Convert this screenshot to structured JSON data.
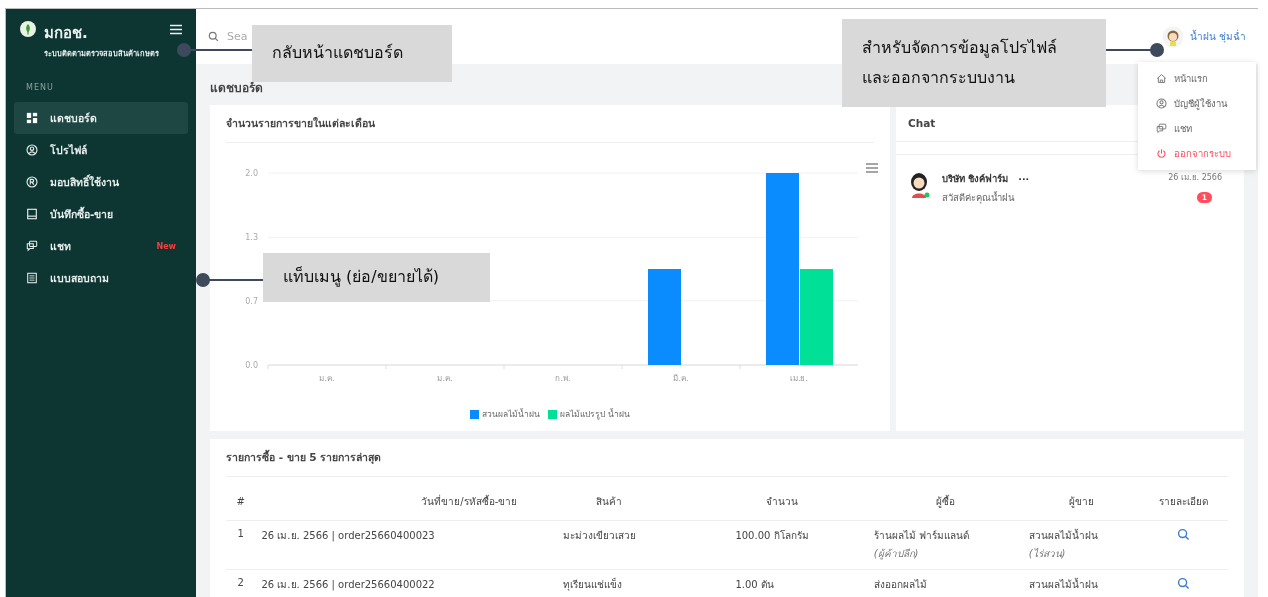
{
  "brand": {
    "name": "มกอช.",
    "subtitle": "ระบบติดตามตรวจสอบสินค้าเกษตร"
  },
  "sidebar": {
    "section": "MENU",
    "items": [
      {
        "label": "แดชบอร์ด",
        "selected": true
      },
      {
        "label": "โปรไฟล์",
        "selected": false
      },
      {
        "label": "มอบสิทธิ์ใช้งาน",
        "selected": false
      },
      {
        "label": "บันทึกซื้อ-ขาย",
        "selected": false
      },
      {
        "label": "แชท",
        "selected": false,
        "badge": "New"
      },
      {
        "label": "แบบสอบถาม",
        "selected": false
      }
    ]
  },
  "search": {
    "placeholder": "Sea"
  },
  "user": {
    "name": "น้ำฝน ชุ่มฉ่ำ"
  },
  "user_menu": [
    {
      "label": "หน้าแรก",
      "kind": "normal"
    },
    {
      "label": "บัญชีผู้ใช้งาน",
      "kind": "normal"
    },
    {
      "label": "แชท",
      "kind": "normal"
    },
    {
      "label": "ออกจากระบบ",
      "kind": "danger"
    }
  ],
  "page_title": "แดชบอร์ด",
  "sales_chart": {
    "title": "จำนวนรายการขายในแต่ละเดือน",
    "chart_data": {
      "type": "bar",
      "categories": [
        "ม.ค.",
        "ม.ค.",
        "ก.พ.",
        "มี.ค.",
        "เม.ย."
      ],
      "series": [
        {
          "name": "สวนผลไม้น้ำฝน",
          "color": "#0a8cff",
          "values": [
            0,
            0,
            0,
            1,
            2
          ]
        },
        {
          "name": "ผลไม้แปรรูป น้ำฝน",
          "color": "#00e096",
          "values": [
            0,
            0,
            0,
            0,
            1
          ]
        }
      ],
      "ylim": [
        0,
        2
      ],
      "yticks": [
        {
          "value": 0,
          "label": "0.0"
        },
        {
          "value": 0.67,
          "label": "0.7"
        },
        {
          "value": 1.33,
          "label": "1.3"
        },
        {
          "value": 2,
          "label": "2.0"
        }
      ]
    }
  },
  "chat": {
    "title": "Chat",
    "items": [
      {
        "name": "บริษัท ชิงค์ฟาร์ม",
        "more": "...",
        "message": "สวัสดีค่ะคุณน้ำฝน",
        "date": "26 เม.ย. 2566",
        "unread": "1"
      }
    ]
  },
  "transactions": {
    "title": "รายการซื้อ - ขาย 5 รายการล่าสุด",
    "columns": [
      "#",
      "วันที่ขาย/รหัสซื้อ-ขาย",
      "สินค้า",
      "จำนวน",
      "ผู้ซื้อ",
      "ผู้ขาย",
      "รายละเอียด"
    ],
    "rows": [
      {
        "no": "1",
        "date_code": "26 เม.ย. 2566 | order25660400023",
        "product": "มะม่วงเขียวเสวย",
        "quantity": "100.00 กิโลกรัม",
        "buyer": "ร้านผลไม้ ฟาร์มแลนด์",
        "buyer_note": "(ผู้ค้าปลีก)",
        "seller": "สวนผลไม้น้ำฝน",
        "seller_note": "(ไร่สวน)"
      },
      {
        "no": "2",
        "date_code": "26 เม.ย. 2566 | order25660400022",
        "product": "ทุเรียนแช่แข็ง",
        "quantity": "1.00 ตัน",
        "buyer": "ส่งออกผลไม้",
        "seller": "สวนผลไม้น้ำฝน"
      }
    ]
  },
  "callouts": [
    "กลับหน้าแดชบอร์ด",
    "แท็บเมนู (ย่อ/ขยายได้)",
    "สำหรับจัดการข้อมูลโปรไฟล์\nและออกจากระบบงาน"
  ]
}
